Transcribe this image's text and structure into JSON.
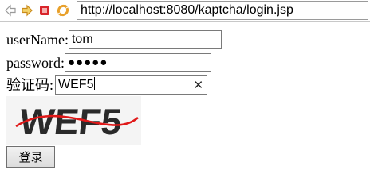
{
  "browser": {
    "url": "http://localhost:8080/kaptcha/login.jsp"
  },
  "form": {
    "username_label": "userName:",
    "username_value": "tom",
    "password_label": "password:",
    "password_masked": "●●●●●",
    "captcha_label": "验证码:",
    "captcha_value": "WEF5",
    "captcha_image_text": "WEF5",
    "submit_label": "登录"
  },
  "icons": {
    "back": "back-arrow-icon",
    "forward": "forward-arrow-icon",
    "stop": "stop-icon",
    "refresh": "refresh-icon",
    "clear": "clear-icon"
  },
  "colors": {
    "stop_red": "#d9252b",
    "nav_orange": "#e8a02a",
    "captcha_ink": "#2a2a2a",
    "captcha_noise_line": "#e01818"
  }
}
